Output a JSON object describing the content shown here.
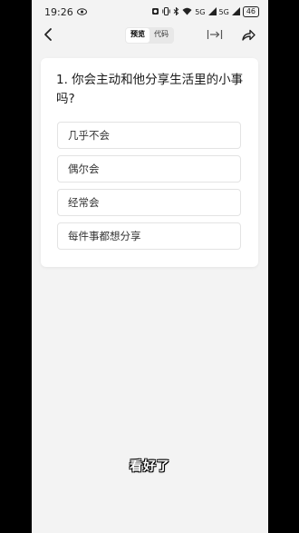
{
  "status_bar": {
    "time": "19:26",
    "signal_1": "5G",
    "signal_2": "5G",
    "battery": "46"
  },
  "header": {
    "tabs": [
      {
        "label": "预览",
        "active": true
      },
      {
        "label": "代码",
        "active": false
      }
    ],
    "icons": {
      "back": "chevron-left-icon",
      "expand": "expand-arrow-icon",
      "share": "share-arrow-icon"
    }
  },
  "survey": {
    "question": "1. 你会主动和他分享生活里的小事吗?",
    "options": [
      {
        "label": "几乎不会"
      },
      {
        "label": "偶尔会"
      },
      {
        "label": "经常会"
      },
      {
        "label": "每件事都想分享"
      }
    ]
  },
  "caption": "看好了",
  "colors": {
    "frame": "#000000",
    "screen_background": "#f3f3f3",
    "card_background": "#ffffff",
    "option_border": "#e3e3e3"
  }
}
